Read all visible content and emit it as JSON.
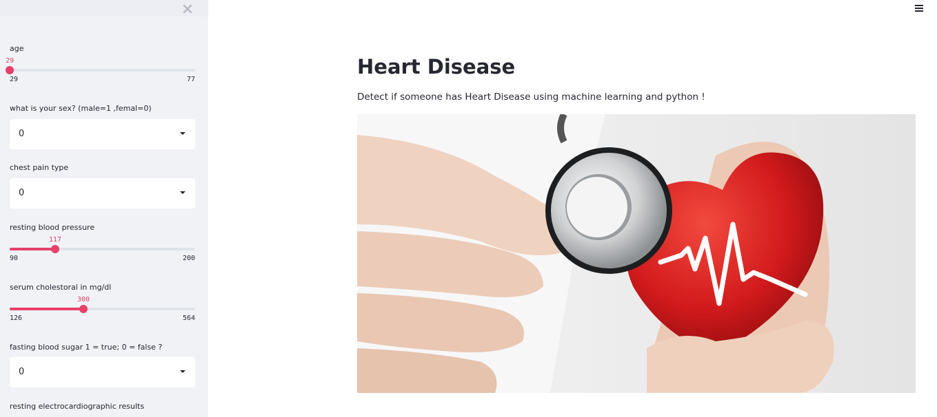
{
  "sidebar": {
    "controls": [
      {
        "type": "slider",
        "label": "age",
        "value": 29,
        "min": 29,
        "max": 77
      },
      {
        "type": "select",
        "label": "what is your sex? (male=1 ,femal=0)",
        "value": "0"
      },
      {
        "type": "select",
        "label": "chest pain type",
        "value": "0"
      },
      {
        "type": "slider",
        "label": "resting blood pressure",
        "value": 117,
        "min": 90,
        "max": 200
      },
      {
        "type": "slider",
        "label": "serum cholestoral in mg/dl",
        "value": 300,
        "min": 126,
        "max": 564
      },
      {
        "type": "select",
        "label": "fasting blood sugar 1 = true; 0 = false ?",
        "value": "0"
      },
      {
        "type": "select",
        "label": "resting electrocardiographic results",
        "value": ""
      }
    ]
  },
  "main": {
    "title": "Heart Disease",
    "subtitle": "Detect if someone has Heart Disease using machine learning and python !"
  },
  "icons": {
    "close": "close-icon",
    "menu": "hamburger-menu-icon",
    "caret": "chevron-down-icon"
  },
  "colors": {
    "accent": "#e6416a",
    "sidebar_bg": "#f0f2f6",
    "text": "#262730"
  }
}
